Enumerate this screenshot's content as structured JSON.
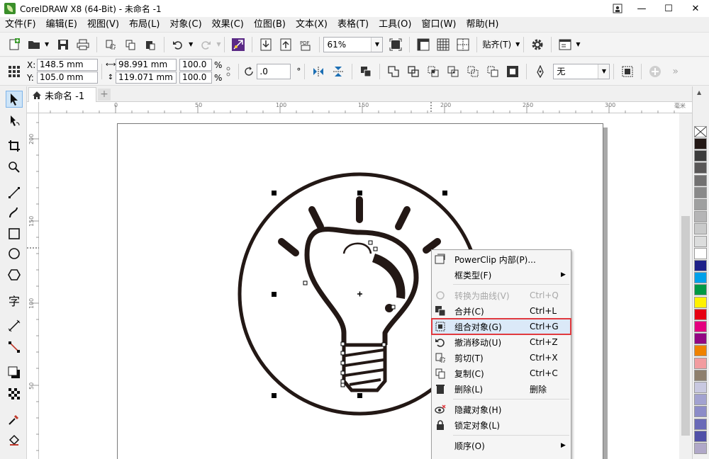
{
  "window": {
    "title": "CorelDRAW X8 (64-Bit) - 未命名 -1",
    "minimize": "—",
    "maximize": "☐",
    "close": "✕"
  },
  "menu": [
    "文件(F)",
    "编辑(E)",
    "视图(V)",
    "布局(L)",
    "对象(C)",
    "效果(C)",
    "位图(B)",
    "文本(X)",
    "表格(T)",
    "工具(O)",
    "窗口(W)",
    "帮助(H)"
  ],
  "toolbar": {
    "zoom": "61%",
    "snap_label": "贴齐(T)"
  },
  "properties": {
    "x_label": "X:",
    "x_value": "148.5 mm",
    "y_label": "Y:",
    "y_value": "105.0 mm",
    "width_value": "98.991 mm",
    "height_value": "119.071 mm",
    "scale_x": "100.0",
    "scale_y": "100.0",
    "percent": "%",
    "rotation": ".0",
    "degree": "°",
    "outline": "无"
  },
  "tabs": [
    {
      "label": "未命名 -1"
    }
  ],
  "add_tab": "+",
  "ruler": {
    "h_ticks": [
      "0",
      "50",
      "100",
      "150",
      "200",
      "250",
      "300"
    ],
    "h_unit": "毫米",
    "v_ticks": [
      "200",
      "150",
      "100",
      "50"
    ]
  },
  "palette": {
    "colors": [
      "#231815",
      "#3c3c3c",
      "#595757",
      "#727171",
      "#898989",
      "#9fa0a0",
      "#b5b5b6",
      "#c9caca",
      "#dcdddd",
      "#ffffff",
      "#1d2088",
      "#00a0e9",
      "#009944",
      "#fff100",
      "#e60012",
      "#e4007f",
      "#920783",
      "#ef8200",
      "#f29c9f",
      "#8e7f6d",
      "#c8c8e0",
      "#a2a2d0",
      "#8c8cc8",
      "#6a6ab8",
      "#5050a8",
      "#b0a8c8"
    ]
  },
  "context_menu": {
    "items": [
      {
        "label": "PowerClip 内部(P)...",
        "shortcut": "",
        "submenu": false,
        "disabled": false,
        "icon": "powerclip-icon"
      },
      {
        "label": "框类型(F)",
        "shortcut": "",
        "submenu": true,
        "disabled": false,
        "icon": ""
      },
      {
        "label": "转换为曲线(V)",
        "shortcut": "Ctrl+Q",
        "submenu": false,
        "disabled": true,
        "icon": "convert-curve-icon"
      },
      {
        "label": "合并(C)",
        "shortcut": "Ctrl+L",
        "submenu": false,
        "disabled": false,
        "icon": "combine-icon"
      },
      {
        "label": "组合对象(G)",
        "shortcut": "Ctrl+G",
        "submenu": false,
        "disabled": false,
        "icon": "group-icon",
        "highlighted": true
      },
      {
        "label": "撤消移动(U)",
        "shortcut": "Ctrl+Z",
        "submenu": false,
        "disabled": false,
        "icon": "undo-icon"
      },
      {
        "label": "剪切(T)",
        "shortcut": "Ctrl+X",
        "submenu": false,
        "disabled": false,
        "icon": "cut-icon"
      },
      {
        "label": "复制(C)",
        "shortcut": "Ctrl+C",
        "submenu": false,
        "disabled": false,
        "icon": "copy-icon"
      },
      {
        "label": "删除(L)",
        "shortcut": "删除",
        "submenu": false,
        "disabled": false,
        "icon": "delete-icon"
      },
      {
        "label": "隐藏对象(H)",
        "shortcut": "",
        "submenu": false,
        "disabled": false,
        "icon": "hide-icon"
      },
      {
        "label": "锁定对象(L)",
        "shortcut": "",
        "submenu": false,
        "disabled": false,
        "icon": "lock-icon"
      },
      {
        "label": "顺序(O)",
        "shortcut": "",
        "submenu": true,
        "disabled": false,
        "icon": ""
      }
    ],
    "highlight_color": "#e0393e"
  }
}
